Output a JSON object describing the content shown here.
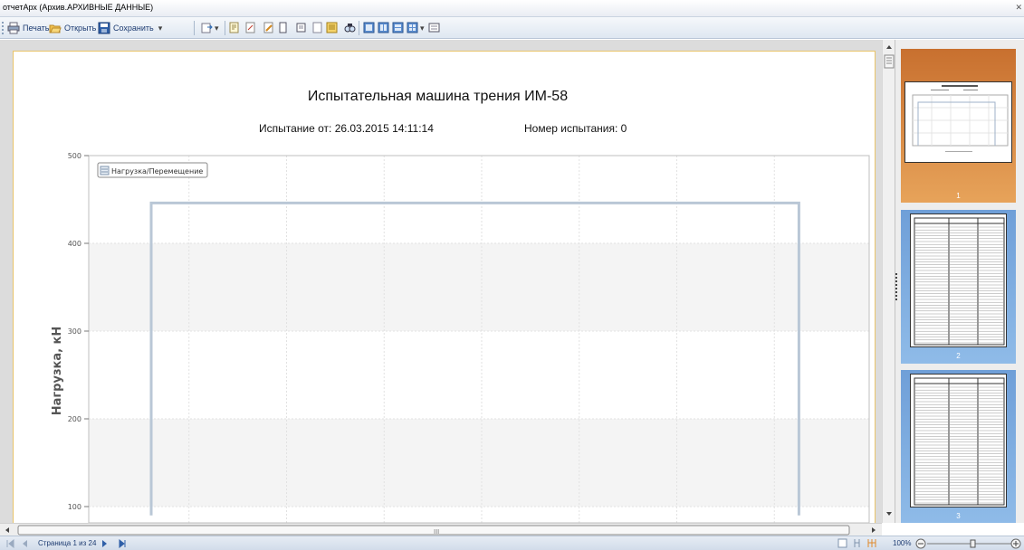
{
  "window": {
    "title": "отчетАрх (Архив.АРХИВНЫЕ ДАННЫЕ)"
  },
  "toolbar": {
    "print_label": "Печать",
    "open_label": "Открыть",
    "save_label": "Сохранить"
  },
  "report": {
    "title": "Испытательная машина трения ИМ-58",
    "test_date_label": "Испытание от: 26.03.2015 14:11:14",
    "test_number_label": "Номер испытания: 0"
  },
  "chart_data": {
    "type": "line",
    "ylabel": "Нагрузка, кН",
    "legend": "Нагрузка/Перемещение",
    "legend_position": "top-left",
    "y_ticks": [
      "500",
      "400",
      "300",
      "200",
      "100"
    ],
    "y_visible_range": [
      90,
      500
    ],
    "grid": true,
    "series": [
      {
        "name": "Нагрузка/Перемещение",
        "color": "#b9c7d6",
        "points": [
          [
            0.08,
            90
          ],
          [
            0.08,
            446
          ],
          [
            0.91,
            446
          ],
          [
            0.91,
            90
          ]
        ]
      }
    ]
  },
  "thumbnails": [
    {
      "label": "1",
      "selected": true
    },
    {
      "label": "2",
      "selected": false
    },
    {
      "label": "3",
      "selected": false
    }
  ],
  "hscroll": {
    "grip": "III"
  },
  "status": {
    "page_info": "Страница 1 из 24",
    "zoom": "100%"
  },
  "colors": {
    "accent": "#e7a35a",
    "selected_thumb_top": "#d98a4c",
    "toolbar_text": "#1e3c72"
  }
}
